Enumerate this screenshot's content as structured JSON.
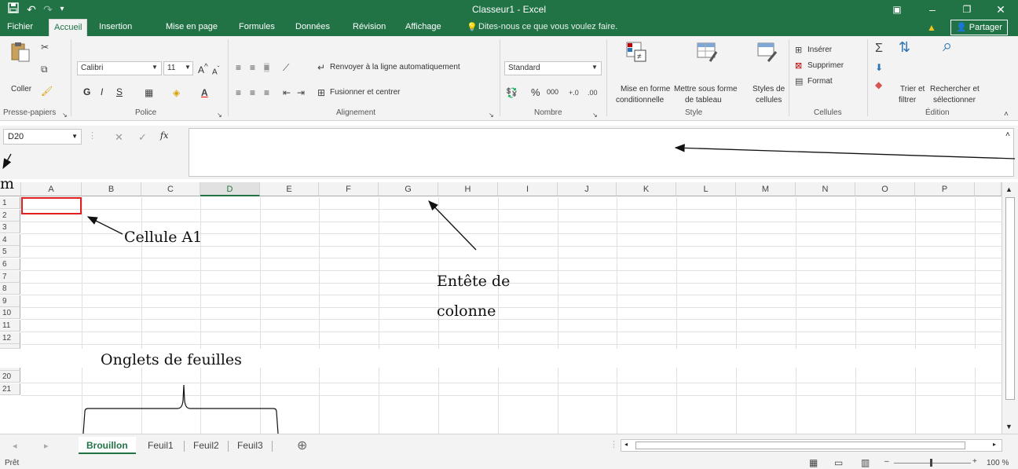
{
  "window": {
    "title": "Classeur1 - Excel"
  },
  "menu": {
    "tabs": [
      {
        "label": "Fichier"
      },
      {
        "label": "Accueil"
      },
      {
        "label": "Insertion"
      },
      {
        "label": "Mise en page"
      },
      {
        "label": "Formules"
      },
      {
        "label": "Données"
      },
      {
        "label": "Révision"
      },
      {
        "label": "Affichage"
      }
    ],
    "tell_me": "Dites-nous ce que vous voulez faire.",
    "share": "Partager"
  },
  "ribbon": {
    "clipboard": {
      "paste": "Coller",
      "group": "Presse-papiers"
    },
    "font": {
      "name": "Calibri",
      "size": "11",
      "bold": "G",
      "italic": "I",
      "underline": "S",
      "group": "Police"
    },
    "alignment": {
      "wrap": "Renvoyer à la ligne automatiquement",
      "merge": "Fusionner et centrer",
      "group": "Alignement"
    },
    "number": {
      "format": "Standard",
      "percent": "%",
      "thousands": "000",
      "group": "Nombre"
    },
    "style": {
      "conditional_1": "Mise en forme",
      "conditional_2": "conditionnelle",
      "table_1": "Mettre sous forme",
      "table_2": "de tableau",
      "cell_styles_1": "Styles de",
      "cell_styles_2": "cellules",
      "group": "Style"
    },
    "cells": {
      "insert": "Insérer",
      "delete": "Supprimer",
      "format": "Format",
      "group": "Cellules"
    },
    "editing": {
      "sort_1": "Trier et",
      "sort_2": "filtrer",
      "find_1": "Rechercher et",
      "find_2": "sélectionner",
      "group": "Édition"
    }
  },
  "formula_bar": {
    "name_box": "D20",
    "fx": "fx",
    "value": ""
  },
  "grid": {
    "columns": [
      "A",
      "B",
      "C",
      "D",
      "E",
      "F",
      "G",
      "H",
      "I",
      "J",
      "K",
      "L",
      "M",
      "N",
      "O",
      "P"
    ],
    "selected_column": "D",
    "rows_top": [
      "1",
      "2",
      "3",
      "4",
      "5",
      "6",
      "7",
      "8",
      "9",
      "10",
      "11",
      "12"
    ],
    "rows_bottom": [
      "20",
      "21"
    ]
  },
  "sheets": {
    "tabs": [
      "Brouillon",
      "Feuil1",
      "Feuil2",
      "Feuil3"
    ],
    "active": "Brouillon"
  },
  "status": {
    "text": "Prêt",
    "zoom": "100 %"
  },
  "annotations": {
    "cell_a1": "Cellule A1",
    "column_header_1": "Entête de",
    "column_header_2": "colonne",
    "sheet_tabs": "Onglets de feuilles",
    "stray": "m"
  },
  "colors": {
    "excel_green": "#217346",
    "cell_highlight": "#e02020"
  }
}
